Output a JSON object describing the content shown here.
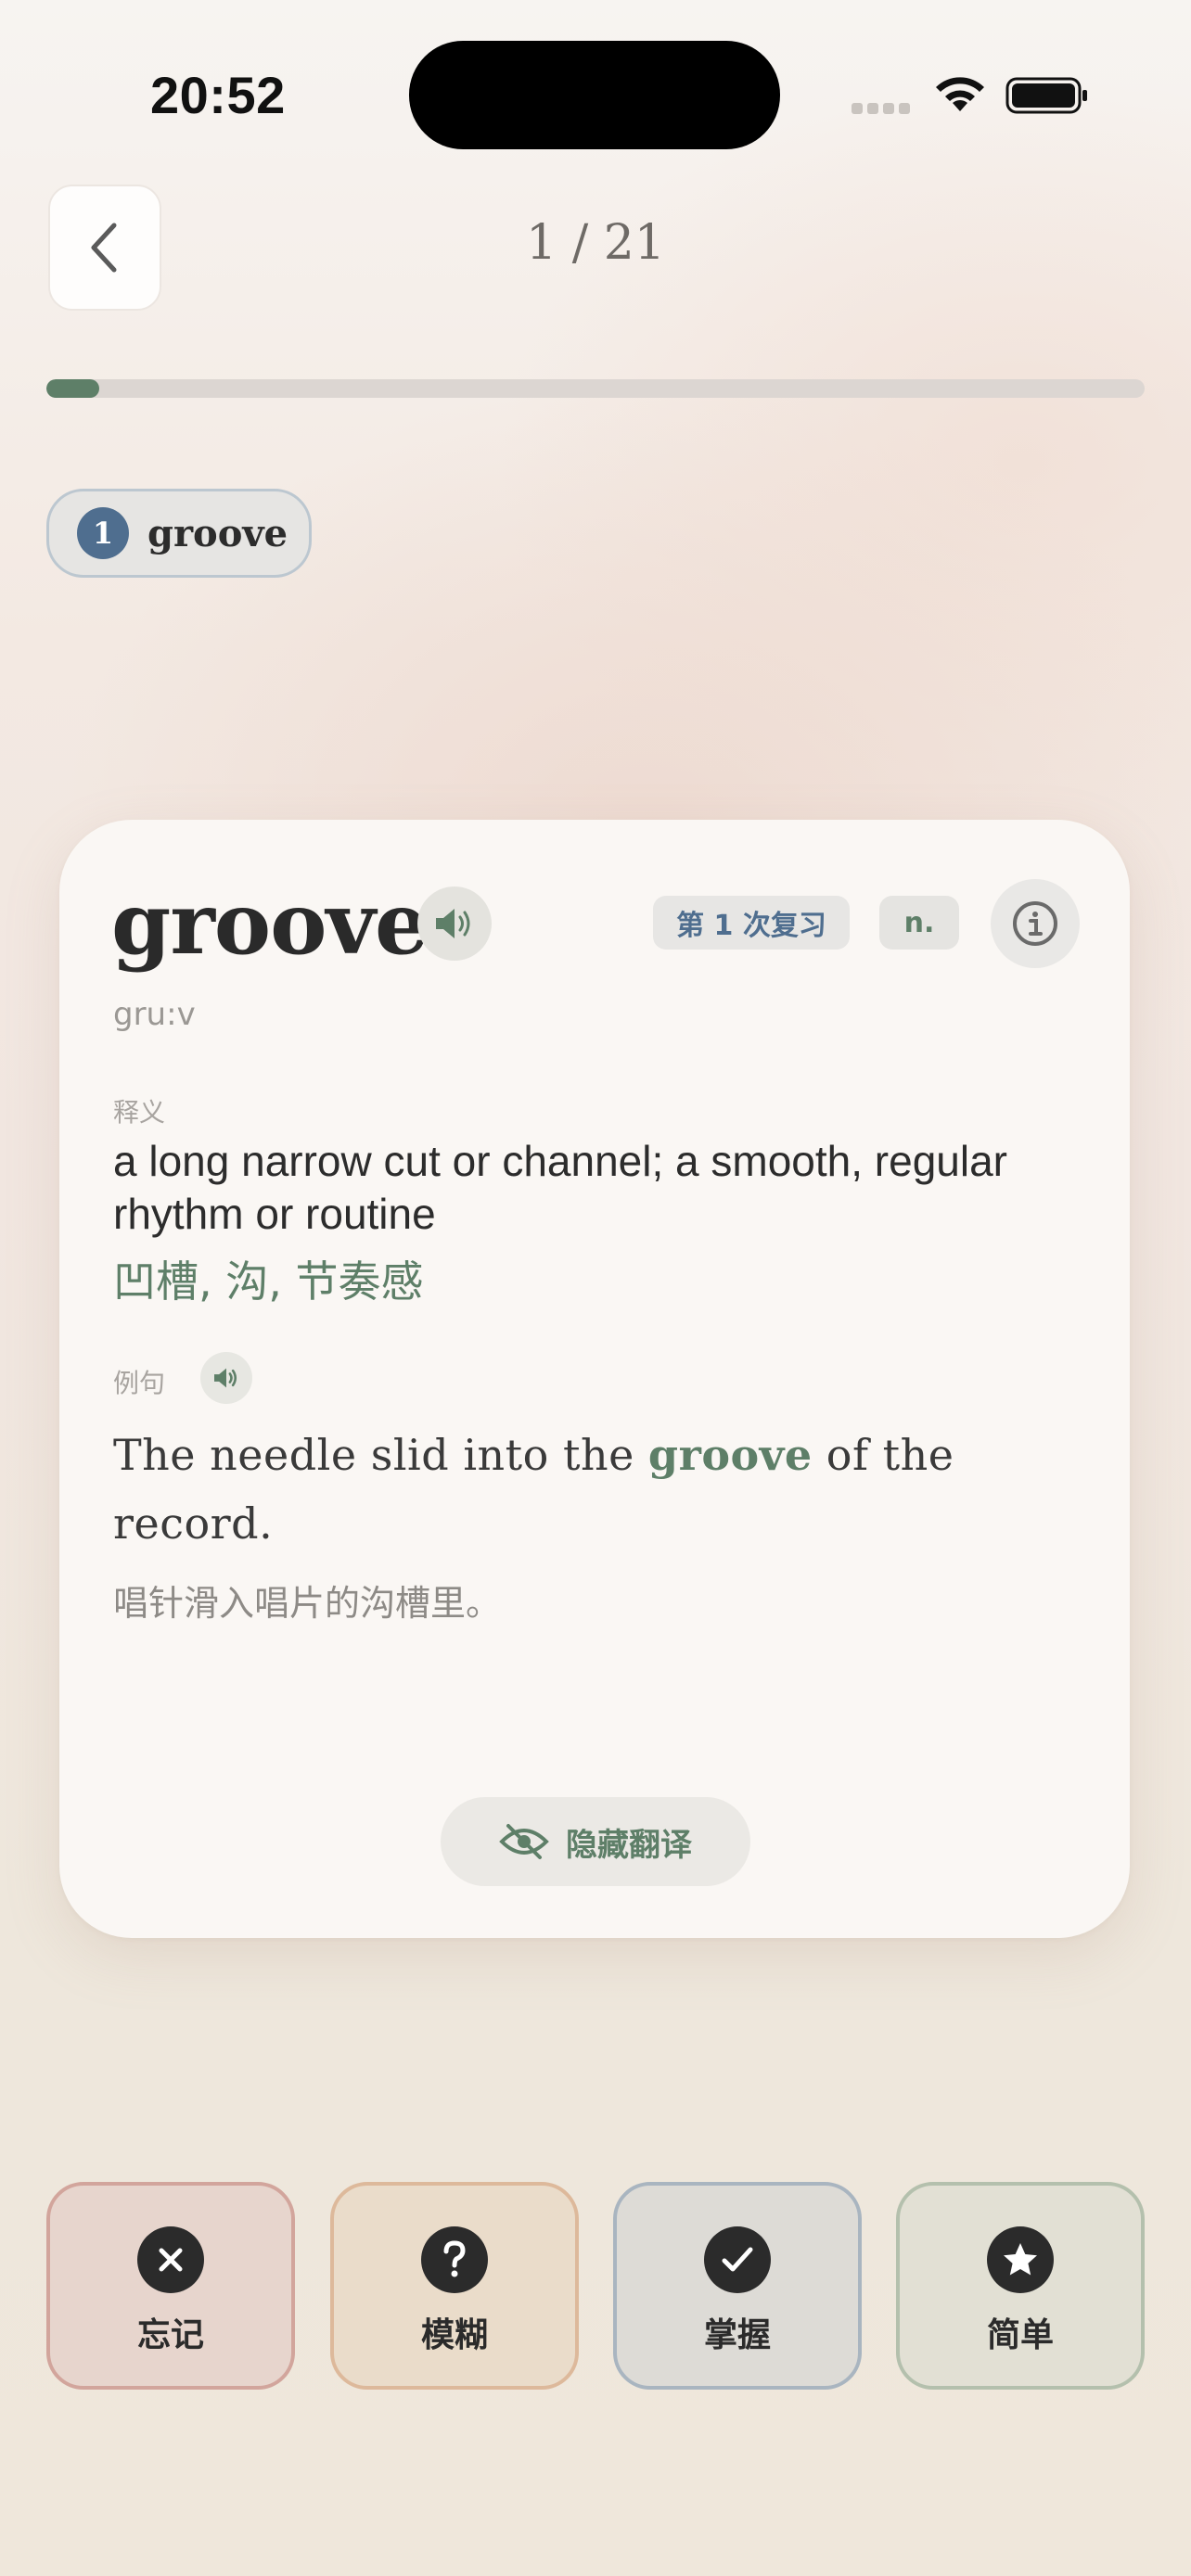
{
  "status_bar": {
    "time": "20:52"
  },
  "header": {
    "counter": "1 / 21"
  },
  "progress": {
    "current": 1,
    "total": 21,
    "fraction": 0.048
  },
  "chip": {
    "index": "1",
    "word": "groove"
  },
  "card": {
    "word": "groove",
    "review_badge": "第 1 次复习",
    "part_of_speech": "n.",
    "phonetic": "gru:v",
    "definition_label": "释义",
    "definition": "a long narrow cut or channel; a smooth, regular rhythm or routine",
    "translation": "凹槽, 沟, 节奏感",
    "example_label": "例句",
    "example_before": "The needle slid into the ",
    "example_highlight": "groove",
    "example_after": " of the record.",
    "example_translation": "唱针滑入唱片的沟槽里。",
    "hide_translation_label": "隐藏翻译"
  },
  "ratings": [
    {
      "label": "忘记",
      "icon": "x-icon"
    },
    {
      "label": "模糊",
      "icon": "question-icon"
    },
    {
      "label": "掌握",
      "icon": "check-icon"
    },
    {
      "label": "简单",
      "icon": "star-icon"
    }
  ],
  "colors": {
    "accent_green": "#5e7f68",
    "accent_blue": "#4f6e8f"
  }
}
